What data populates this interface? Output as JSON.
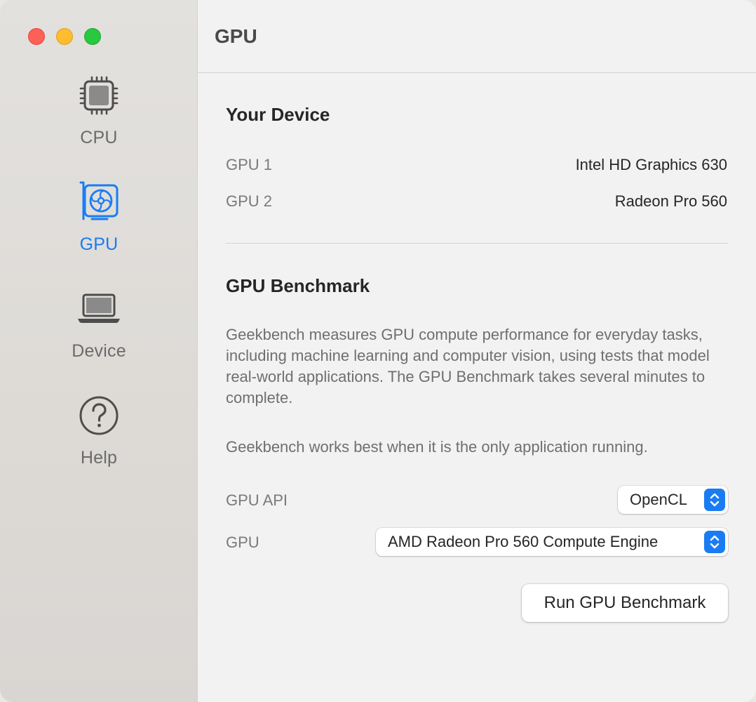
{
  "sidebar": {
    "items": [
      {
        "label": "CPU",
        "icon": "cpu-chip-icon",
        "active": false
      },
      {
        "label": "GPU",
        "icon": "graphics-card-icon",
        "active": true
      },
      {
        "label": "Device",
        "icon": "laptop-icon",
        "active": false
      },
      {
        "label": "Help",
        "icon": "question-circle-icon",
        "active": false
      }
    ]
  },
  "header": {
    "title": "GPU"
  },
  "device": {
    "title": "Your Device",
    "rows": [
      {
        "key": "GPU 1",
        "value": "Intel HD Graphics 630"
      },
      {
        "key": "GPU 2",
        "value": "Radeon Pro 560"
      }
    ]
  },
  "benchmark": {
    "title": "GPU Benchmark",
    "description": "Geekbench measures GPU compute performance for everyday tasks, including machine learning and computer vision, using tests that model real-world applications. The GPU Benchmark takes several minutes to complete.",
    "note": "Geekbench works best when it is the only application running.",
    "api_label": "GPU API",
    "api_value": "OpenCL",
    "gpu_label": "GPU",
    "gpu_value": "AMD Radeon Pro 560 Compute Engine",
    "run_label": "Run GPU Benchmark"
  },
  "colors": {
    "accent": "#1a7cf3",
    "close": "#fe5f57",
    "minimize": "#febc2e",
    "zoom": "#28c840"
  }
}
